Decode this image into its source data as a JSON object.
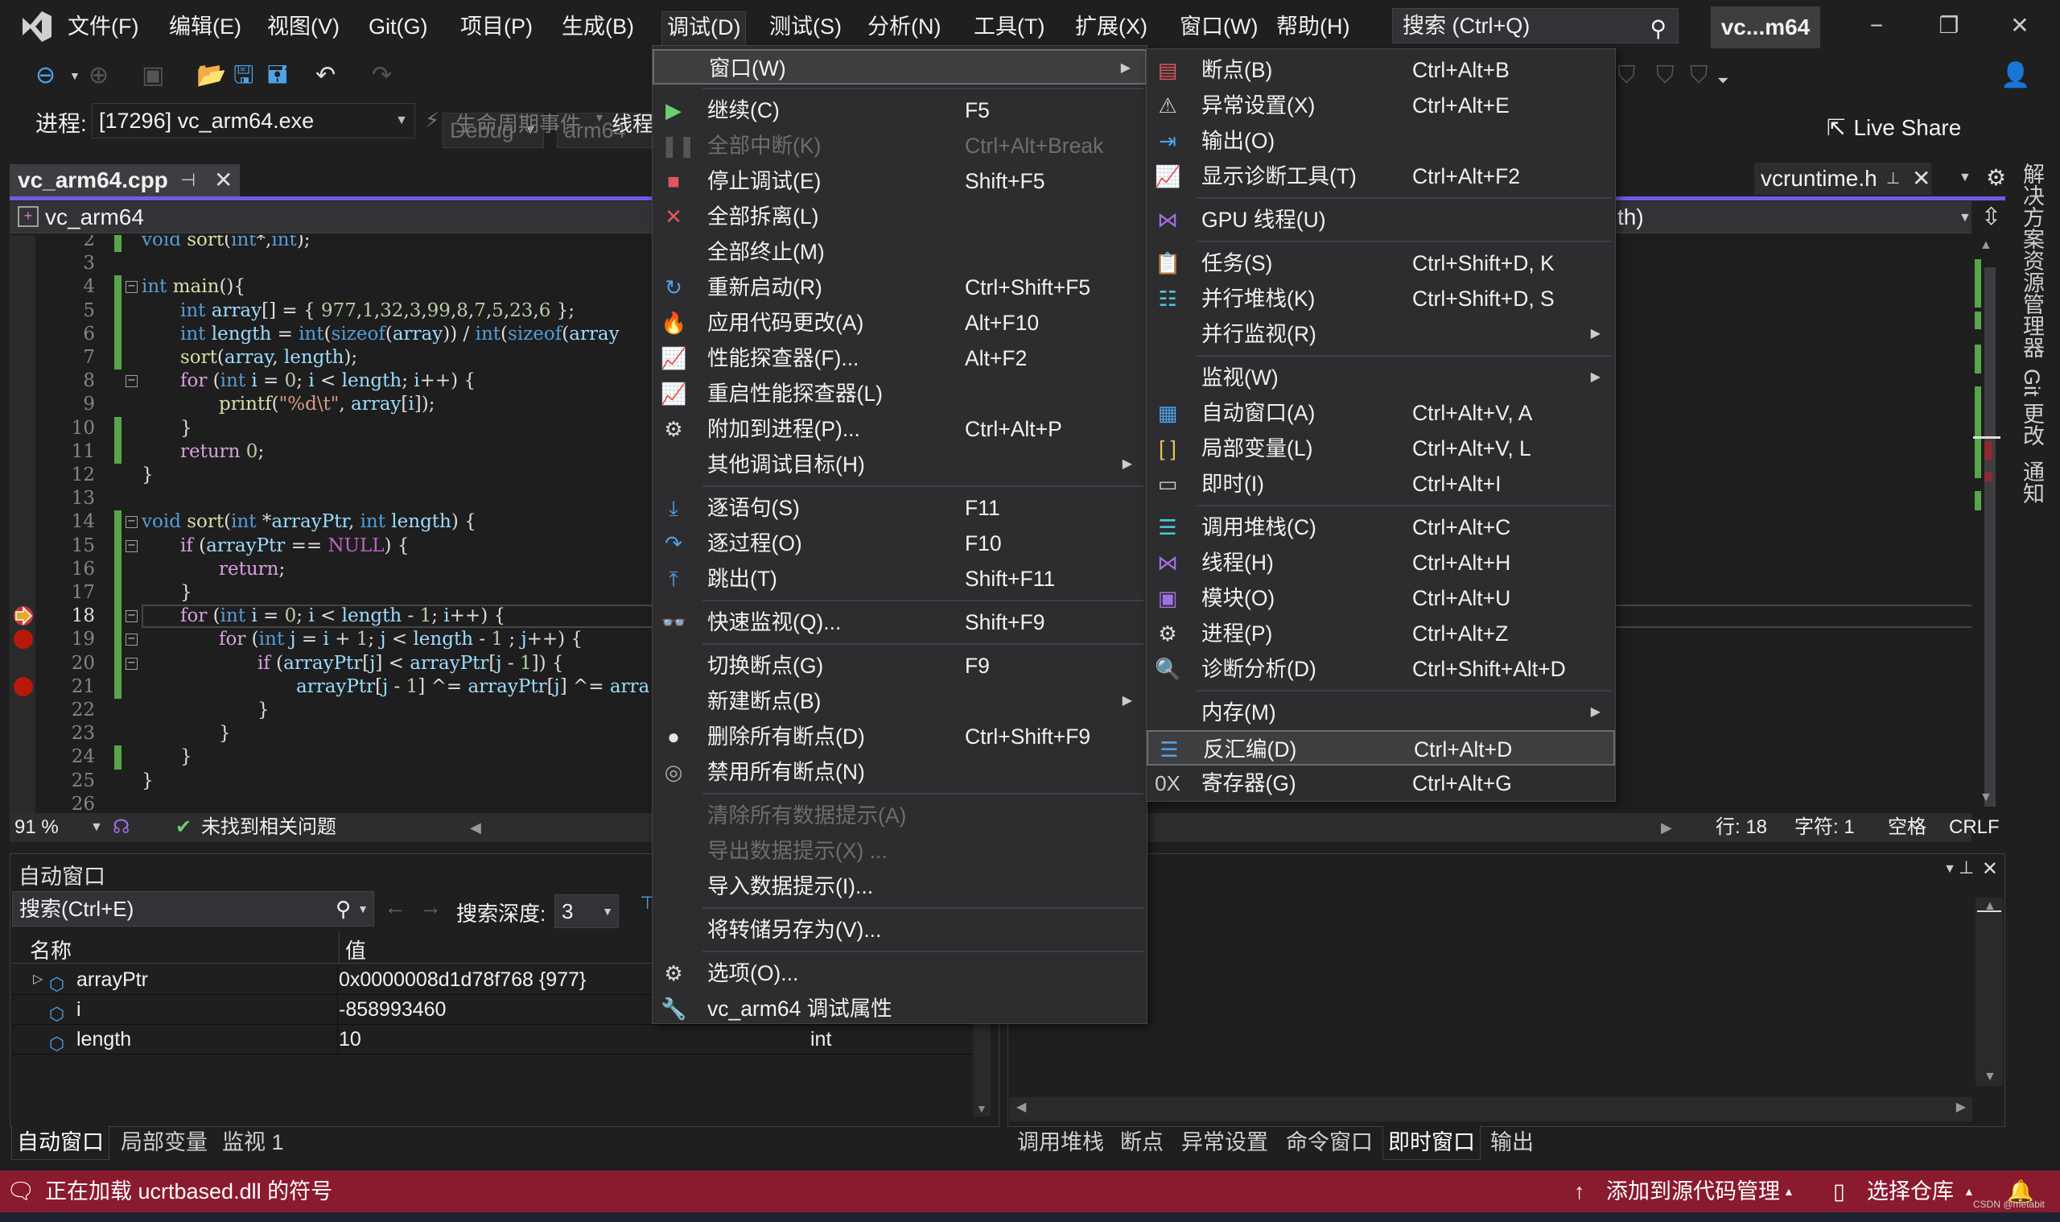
{
  "app": {
    "solution_name": "vc...m64",
    "search_placeholder": "搜索 (Ctrl+Q)",
    "menus": [
      "文件(F)",
      "编辑(E)",
      "视图(V)",
      "Git(G)",
      "项目(P)",
      "生成(B)",
      "调试(D)",
      "测试(S)",
      "分析(N)",
      "工具(T)",
      "扩展(X)",
      "窗口(W)",
      "帮助(H)"
    ],
    "active_menu": "调试(D)",
    "window_buttons": {
      "minimize": "−",
      "restore": "❐",
      "close": "✕"
    }
  },
  "toolbar": {
    "config": "Debug",
    "platform": "arm64",
    "live_share": "Live Share",
    "process_label": "进程:",
    "process_value": "[17296] vc_arm64.exe",
    "lifecycle_label": "生命周期事件",
    "thread_label": "线程"
  },
  "editor": {
    "active_tab": "vc_arm64.cpp",
    "other_tab": "vcruntime.h",
    "nav_project": "vc_arm64",
    "nav_right": "th)",
    "zoom": "91 %",
    "issues": "未找到相关问题",
    "line_info": "行: 18",
    "char_info": "字符: 1",
    "indent": "空格",
    "eol": "CRLF",
    "current_line": 18,
    "breakpoint_lines": [
      19,
      21
    ],
    "lines": [
      {
        "n": "2",
        "html": "<span class='kw'>void</span> <span class='fn'>sort</span><span class='pl'>(</span><span class='kw'>int</span><span class='pl'>*,</span><span class='kw'>int</span><span class='pl'>);</span>",
        "indent": 0,
        "chg": true,
        "fold": ""
      },
      {
        "n": "3",
        "html": "",
        "indent": 0,
        "chg": false,
        "fold": ""
      },
      {
        "n": "4",
        "html": "<span class='kw'>int</span> <span class='fn'>main</span><span class='pl'>(){</span>",
        "indent": 0,
        "chg": true,
        "fold": "−"
      },
      {
        "n": "5",
        "html": "<span class='kw'>int</span> <span class='id'>array</span><span class='pl'>[] = { </span><span class='num'>977</span><span class='pl'>,</span><span class='num'>1</span><span class='pl'>,</span><span class='num'>32</span><span class='pl'>,</span><span class='num'>3</span><span class='pl'>,</span><span class='num'>99</span><span class='pl'>,</span><span class='num'>8</span><span class='pl'>,</span><span class='num'>7</span><span class='pl'>,</span><span class='num'>5</span><span class='pl'>,</span><span class='num'>23</span><span class='pl'>,</span><span class='num'>6</span><span class='pl'> };</span>",
        "indent": 1,
        "chg": true,
        "fold": ""
      },
      {
        "n": "6",
        "html": "<span class='kw'>int</span> <span class='id'>length</span><span class='pl'> = </span><span class='kw'>int</span><span class='pl'>(</span><span class='kw'>sizeof</span><span class='pl'>(</span><span class='id'>array</span><span class='pl'>)) / </span><span class='kw'>int</span><span class='pl'>(</span><span class='kw'>sizeof</span><span class='pl'>(</span><span class='id'>array</span>",
        "indent": 1,
        "chg": true,
        "fold": ""
      },
      {
        "n": "7",
        "html": "<span class='fn'>sort</span><span class='pl'>(</span><span class='id'>array</span><span class='pl'>, </span><span class='id'>length</span><span class='pl'>);</span>",
        "indent": 1,
        "chg": true,
        "fold": ""
      },
      {
        "n": "8",
        "html": "<span class='cf'>for</span><span class='pl'> (</span><span class='kw'>int</span> <span class='id'>i</span><span class='pl'> = </span><span class='num'>0</span><span class='pl'>; </span><span class='id'>i</span><span class='pl'> &lt; </span><span class='id'>length</span><span class='pl'>; </span><span class='id'>i</span><span class='pl'>++) {</span>",
        "indent": 1,
        "chg": false,
        "fold": "−"
      },
      {
        "n": "9",
        "html": "<span class='fn'>printf</span><span class='pl'>(</span><span class='str'>\"%d\\t\"</span><span class='pl'>, </span><span class='id'>array</span><span class='pl'>[</span><span class='id'>i</span><span class='pl'>]);</span>",
        "indent": 2,
        "chg": false,
        "fold": ""
      },
      {
        "n": "10",
        "html": "<span class='pl'>}</span>",
        "indent": 1,
        "chg": true,
        "fold": ""
      },
      {
        "n": "11",
        "html": "<span class='cf'>return</span> <span class='num'>0</span><span class='pl'>;</span>",
        "indent": 1,
        "chg": true,
        "fold": ""
      },
      {
        "n": "12",
        "html": "<span class='pl'>}</span>",
        "indent": 0,
        "chg": false,
        "fold": ""
      },
      {
        "n": "13",
        "html": "",
        "indent": 0,
        "chg": false,
        "fold": ""
      },
      {
        "n": "14",
        "html": "<span class='kw'>void</span> <span class='fn'>sort</span><span class='pl'>(</span><span class='kw'>int</span><span class='pl'> *</span><span class='id'>arrayPtr</span><span class='pl'>, </span><span class='kw'>int</span> <span class='id'>length</span><span class='pl'>) {</span>",
        "indent": 0,
        "chg": true,
        "fold": "−"
      },
      {
        "n": "15",
        "html": "<span class='cf'>if</span><span class='pl'> (</span><span class='id'>arrayPtr</span><span class='pl'> == </span><span class='mac'>NULL</span><span class='pl'>) {</span>",
        "indent": 1,
        "chg": true,
        "fold": "−"
      },
      {
        "n": "16",
        "html": "<span class='cf'>return</span><span class='pl'>;</span>",
        "indent": 2,
        "chg": true,
        "fold": ""
      },
      {
        "n": "17",
        "html": "<span class='pl'>}</span>",
        "indent": 1,
        "chg": true,
        "fold": ""
      },
      {
        "n": "18",
        "html": "<span class='cf'>for</span><span class='pl'> (</span><span class='kw'>int</span> <span class='id'>i</span><span class='pl'> = </span><span class='num'>0</span><span class='pl'>; </span><span class='id'>i</span><span class='pl'> &lt; </span><span class='id'>length</span><span class='pl'> - </span><span class='num'>1</span><span class='pl'>; </span><span class='id'>i</span><span class='pl'>++) {</span>",
        "indent": 1,
        "chg": true,
        "fold": "−"
      },
      {
        "n": "19",
        "html": "<span class='cf'>for</span><span class='pl'> (</span><span class='kw'>int</span> <span class='id'>j</span><span class='pl'> = </span><span class='id'>i</span><span class='pl'> + </span><span class='num'>1</span><span class='pl'>; </span><span class='id'>j</span><span class='pl'> &lt; </span><span class='id'>length</span><span class='pl'> - </span><span class='num'>1</span><span class='pl'> ; </span><span class='id'>j</span><span class='pl'>++) {</span>",
        "indent": 2,
        "chg": true,
        "fold": "−"
      },
      {
        "n": "20",
        "html": "<span class='cf'>if</span><span class='pl'> (</span><span class='id'>arrayPtr</span><span class='pl'>[</span><span class='id'>j</span><span class='pl'>] &lt; </span><span class='id'>arrayPtr</span><span class='pl'>[</span><span class='id'>j</span><span class='pl'> - </span><span class='num'>1</span><span class='pl'>]) {</span>",
        "indent": 3,
        "chg": true,
        "fold": "−"
      },
      {
        "n": "21",
        "html": "<span class='id'>arrayPtr</span><span class='pl'>[</span><span class='id'>j</span><span class='pl'> - </span><span class='num'>1</span><span class='pl'>] ^= </span><span class='id'>arrayPtr</span><span class='pl'>[</span><span class='id'>j</span><span class='pl'>] ^= </span><span class='id'>arra</span>",
        "indent": 4,
        "chg": true,
        "fold": ""
      },
      {
        "n": "22",
        "html": "<span class='pl'>}</span>",
        "indent": 3,
        "chg": false,
        "fold": ""
      },
      {
        "n": "23",
        "html": "<span class='pl'>}</span>",
        "indent": 2,
        "chg": false,
        "fold": ""
      },
      {
        "n": "24",
        "html": "<span class='pl'>}</span>",
        "indent": 1,
        "chg": true,
        "fold": ""
      },
      {
        "n": "25",
        "html": "<span class='pl'>}</span>",
        "indent": 0,
        "chg": false,
        "fold": ""
      },
      {
        "n": "26",
        "html": "",
        "indent": 0,
        "chg": false,
        "fold": ""
      }
    ]
  },
  "debug_menu": {
    "items": [
      {
        "type": "item",
        "label": "窗口(W)",
        "shortcut": "",
        "icon": "",
        "submenu": true,
        "highlight": true,
        "disabled": false
      },
      {
        "type": "sep"
      },
      {
        "type": "item",
        "label": "继续(C)",
        "shortcut": "F5",
        "icon": "continue-icon",
        "glyph": "▶",
        "color": "#6ad16a"
      },
      {
        "type": "item",
        "label": "全部中断(K)",
        "shortcut": "Ctrl+Alt+Break",
        "icon": "pause-icon",
        "glyph": "❚❚",
        "color": "#555",
        "disabled": true
      },
      {
        "type": "item",
        "label": "停止调试(E)",
        "shortcut": "Shift+F5",
        "icon": "stop-icon",
        "glyph": "■",
        "color": "#e05561"
      },
      {
        "type": "item",
        "label": "全部拆离(L)",
        "shortcut": "",
        "icon": "detach-icon",
        "glyph": "✕",
        "color": "#e05561"
      },
      {
        "type": "item",
        "label": "全部终止(M)",
        "shortcut": "",
        "icon": ""
      },
      {
        "type": "item",
        "label": "重新启动(R)",
        "shortcut": "Ctrl+Shift+F5",
        "icon": "restart-icon",
        "glyph": "↻",
        "color": "#4ea3e8"
      },
      {
        "type": "item",
        "label": "应用代码更改(A)",
        "shortcut": "Alt+F10",
        "icon": "hot-reload-icon",
        "glyph": "🔥",
        "color": "#e05561"
      },
      {
        "type": "item",
        "label": "性能探查器(F)...",
        "shortcut": "Alt+F2",
        "icon": "profiler-icon",
        "glyph": "📈",
        "color": "#6ad16a"
      },
      {
        "type": "item",
        "label": "重启性能探查器(L)",
        "shortcut": "",
        "icon": "profiler-restart-icon",
        "glyph": "📈",
        "color": "#6ad16a"
      },
      {
        "type": "item",
        "label": "附加到进程(P)...",
        "shortcut": "Ctrl+Alt+P",
        "icon": "attach-process-icon",
        "glyph": "⚙",
        "color": "#ddd"
      },
      {
        "type": "item",
        "label": "其他调试目标(H)",
        "shortcut": "",
        "icon": "",
        "submenu": true
      },
      {
        "type": "sep"
      },
      {
        "type": "item",
        "label": "逐语句(S)",
        "shortcut": "F11",
        "icon": "step-into-icon",
        "glyph": "⤓",
        "color": "#4ea3e8"
      },
      {
        "type": "item",
        "label": "逐过程(O)",
        "shortcut": "F10",
        "icon": "step-over-icon",
        "glyph": "↷",
        "color": "#4ea3e8"
      },
      {
        "type": "item",
        "label": "跳出(T)",
        "shortcut": "Shift+F11",
        "icon": "step-out-icon",
        "glyph": "⤒",
        "color": "#4ea3e8"
      },
      {
        "type": "sep"
      },
      {
        "type": "item",
        "label": "快速监视(Q)...",
        "shortcut": "Shift+F9",
        "icon": "quickwatch-icon",
        "glyph": "👓",
        "color": "#ddd"
      },
      {
        "type": "sep"
      },
      {
        "type": "item",
        "label": "切换断点(G)",
        "shortcut": "F9",
        "icon": ""
      },
      {
        "type": "item",
        "label": "新建断点(B)",
        "shortcut": "",
        "icon": "",
        "submenu": true
      },
      {
        "type": "item",
        "label": "删除所有断点(D)",
        "shortcut": "Ctrl+Shift+F9",
        "icon": "delete-breakpoints-icon",
        "glyph": "●",
        "color": "#e6e6e6"
      },
      {
        "type": "item",
        "label": "禁用所有断点(N)",
        "shortcut": "",
        "icon": "disable-breakpoints-icon",
        "glyph": "◎",
        "color": "#aaa"
      },
      {
        "type": "sep"
      },
      {
        "type": "item",
        "label": "清除所有数据提示(A)",
        "shortcut": "",
        "icon": "",
        "disabled": true
      },
      {
        "type": "item",
        "label": "导出数据提示(X) ...",
        "shortcut": "",
        "icon": "",
        "disabled": true
      },
      {
        "type": "item",
        "label": "导入数据提示(I)...",
        "shortcut": "",
        "icon": ""
      },
      {
        "type": "sep"
      },
      {
        "type": "item",
        "label": "将转储另存为(V)...",
        "shortcut": "",
        "icon": ""
      },
      {
        "type": "sep"
      },
      {
        "type": "item",
        "label": "选项(O)...",
        "shortcut": "",
        "icon": "options-gear-icon",
        "glyph": "⚙",
        "color": "#ddd"
      },
      {
        "type": "item",
        "label": "vc_arm64 调试属性",
        "shortcut": "",
        "icon": "wrench-icon",
        "glyph": "🔧",
        "color": "#ddd"
      }
    ]
  },
  "window_submenu": {
    "items": [
      {
        "type": "item",
        "label": "断点(B)",
        "shortcut": "Ctrl+Alt+B",
        "icon": "breakpoints-window-icon",
        "glyph": "▤",
        "color": "#e05561"
      },
      {
        "type": "item",
        "label": "异常设置(X)",
        "shortcut": "Ctrl+Alt+E",
        "icon": "exception-settings-icon",
        "glyph": "⚠",
        "color": "#ccc"
      },
      {
        "type": "item",
        "label": "输出(O)",
        "shortcut": "",
        "icon": "output-icon",
        "glyph": "⇥",
        "color": "#4ea3e8"
      },
      {
        "type": "item",
        "label": "显示诊断工具(T)",
        "shortcut": "Ctrl+Alt+F2",
        "icon": "diagnostic-tools-icon",
        "glyph": "📈",
        "color": "#6ad16a"
      },
      {
        "type": "sep"
      },
      {
        "type": "item",
        "label": "GPU 线程(U)",
        "shortcut": "",
        "icon": "gpu-threads-icon",
        "glyph": "⋈",
        "color": "#a070e0"
      },
      {
        "type": "sep"
      },
      {
        "type": "item",
        "label": "任务(S)",
        "shortcut": "Ctrl+Shift+D, K",
        "icon": "tasks-icon",
        "glyph": "📋",
        "color": "#6ad16a"
      },
      {
        "type": "item",
        "label": "并行堆栈(K)",
        "shortcut": "Ctrl+Shift+D, S",
        "icon": "parallel-stacks-icon",
        "glyph": "☷",
        "color": "#4ec9e0"
      },
      {
        "type": "item",
        "label": "并行监视(R)",
        "shortcut": "",
        "icon": "",
        "submenu": true
      },
      {
        "type": "sep"
      },
      {
        "type": "item",
        "label": "监视(W)",
        "shortcut": "",
        "icon": "",
        "submenu": true
      },
      {
        "type": "item",
        "label": "自动窗口(A)",
        "shortcut": "Ctrl+Alt+V, A",
        "icon": "autos-icon",
        "glyph": "▦",
        "color": "#4ea3e8"
      },
      {
        "type": "item",
        "label": "局部变量(L)",
        "shortcut": "Ctrl+Alt+V, L",
        "icon": "locals-icon",
        "glyph": "[ ]",
        "color": "#e8c34e"
      },
      {
        "type": "item",
        "label": "即时(I)",
        "shortcut": "Ctrl+Alt+I",
        "icon": "immediate-icon",
        "glyph": "▭",
        "color": "#ccc"
      },
      {
        "type": "sep"
      },
      {
        "type": "item",
        "label": "调用堆栈(C)",
        "shortcut": "Ctrl+Alt+C",
        "icon": "call-stack-icon",
        "glyph": "☰",
        "color": "#4ec9e0"
      },
      {
        "type": "item",
        "label": "线程(H)",
        "shortcut": "Ctrl+Alt+H",
        "icon": "threads-icon",
        "glyph": "⋈",
        "color": "#a070e0"
      },
      {
        "type": "item",
        "label": "模块(O)",
        "shortcut": "Ctrl+Alt+U",
        "icon": "modules-icon",
        "glyph": "▣",
        "color": "#a070e0"
      },
      {
        "type": "item",
        "label": "进程(P)",
        "shortcut": "Ctrl+Alt+Z",
        "icon": "processes-icon",
        "glyph": "⚙",
        "color": "#ddd"
      },
      {
        "type": "item",
        "label": "诊断分析(D)",
        "shortcut": "Ctrl+Shift+Alt+D",
        "icon": "diagnostic-analysis-icon",
        "glyph": "🔍",
        "color": "#4ea3e8"
      },
      {
        "type": "sep"
      },
      {
        "type": "item",
        "label": "内存(M)",
        "shortcut": "",
        "icon": "",
        "submenu": true
      },
      {
        "type": "item",
        "label": "反汇编(D)",
        "shortcut": "Ctrl+Alt+D",
        "icon": "disassembly-icon",
        "glyph": "☰",
        "color": "#4ea3e8",
        "highlight": true
      },
      {
        "type": "item",
        "label": "寄存器(G)",
        "shortcut": "Ctrl+Alt+G",
        "icon": "registers-icon",
        "glyph": "0X",
        "color": "#ccc"
      }
    ]
  },
  "autos": {
    "title": "自动窗口",
    "search_placeholder": "搜索(Ctrl+E)",
    "search_depth_label": "搜索深度:",
    "search_depth": "3",
    "columns": [
      "名称",
      "值"
    ],
    "rows": [
      {
        "name": "arrayPtr",
        "value": "0x0000008d1d78f768 {977}",
        "type": "",
        "expandable": true
      },
      {
        "name": "i",
        "value": "-858993460",
        "type": "",
        "expandable": false
      },
      {
        "name": "length",
        "value": "10",
        "type": "int",
        "expandable": false
      }
    ]
  },
  "bottom_tabs_left": [
    "自动窗口",
    "局部变量",
    "监视 1"
  ],
  "bottom_tabs_right": [
    "调用堆栈",
    "断点",
    "异常设置",
    "命令窗口",
    "即时窗口",
    "输出"
  ],
  "bottom_left_selected": "自动窗口",
  "bottom_right_selected": "即时窗口",
  "side_tabs": [
    "解决方案资源管理器",
    "Git 更改",
    "通知"
  ],
  "status": {
    "message": "正在加载 ucrtbased.dll 的符号",
    "add_source_control": "添加到源代码管理",
    "select_repo": "选择仓库",
    "watermark": "CSDN @metabit"
  },
  "colors": {
    "status_bar": "#8a1a2e",
    "accent": "#6d5ce8",
    "change_bar": "#57a64a",
    "breakpoint": "#e51400"
  }
}
